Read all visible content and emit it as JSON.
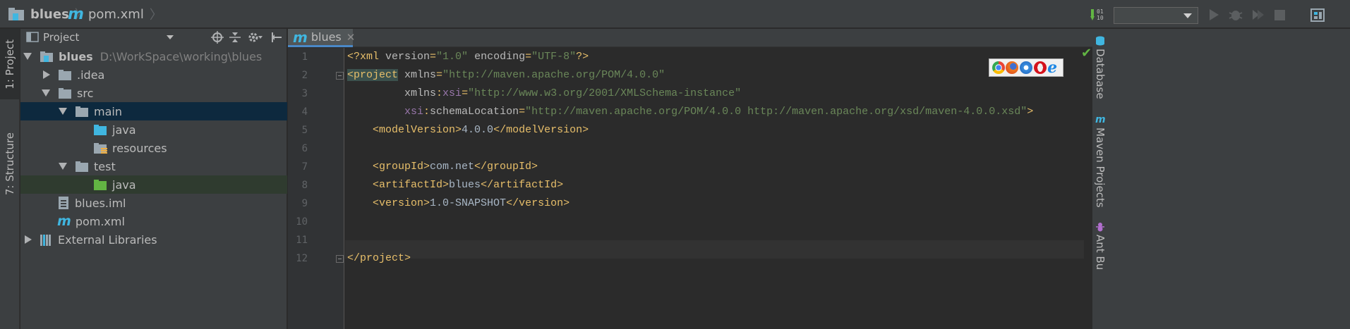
{
  "navbar": {
    "breadcrumbs": [
      "blues",
      "pom.xml"
    ],
    "run_config_value": ""
  },
  "left_strip": {
    "tabs": [
      "1: Project",
      "7: Structure"
    ]
  },
  "project_panel": {
    "title": "Project",
    "tree": [
      {
        "label": "blues",
        "detail": "D:\\WorkSpace\\working\\blues",
        "level": 0,
        "state": "expanded",
        "icon": "module-folder-icon"
      },
      {
        "label": ".idea",
        "level": 1,
        "state": "collapsed",
        "icon": "folder-icon"
      },
      {
        "label": "src",
        "level": 1,
        "state": "expanded",
        "icon": "folder-icon"
      },
      {
        "label": "main",
        "level": 2,
        "state": "expanded",
        "icon": "folder-icon"
      },
      {
        "label": "java",
        "level": 3,
        "state": "leaf",
        "icon": "source-folder-icon"
      },
      {
        "label": "resources",
        "level": 3,
        "state": "leaf",
        "icon": "resources-folder-icon"
      },
      {
        "label": "test",
        "level": 2,
        "state": "expanded",
        "icon": "folder-icon"
      },
      {
        "label": "java",
        "level": 3,
        "state": "leaf",
        "icon": "test-folder-icon"
      },
      {
        "label": "blues.iml",
        "level": 2,
        "state": "leaf",
        "icon": "iml-file-icon"
      },
      {
        "label": "pom.xml",
        "level": 2,
        "state": "leaf",
        "icon": "maven-file-icon"
      },
      {
        "label": "External Libraries",
        "level": 0,
        "state": "collapsed",
        "icon": "libraries-icon"
      }
    ]
  },
  "editor": {
    "tab_label": "blues",
    "line_numbers": [
      "1",
      "2",
      "3",
      "4",
      "5",
      "6",
      "7",
      "8",
      "9",
      "10",
      "11",
      "12"
    ],
    "lines": [
      [
        [
          "tag",
          "<?xml "
        ],
        [
          "attr",
          "version"
        ],
        [
          "tag",
          "="
        ],
        [
          "val",
          "\"1.0\""
        ],
        [
          "tag",
          " "
        ],
        [
          "attr",
          "encoding"
        ],
        [
          "tag",
          "="
        ],
        [
          "val",
          "\"UTF-8\""
        ],
        [
          "tag",
          "?>"
        ]
      ],
      [
        [
          "taghl",
          "<project"
        ],
        [
          "tag",
          " "
        ],
        [
          "attr",
          "xmlns"
        ],
        [
          "tag",
          "="
        ],
        [
          "val",
          "\"http://maven.apache.org/POM/4.0.0\""
        ]
      ],
      [
        [
          "txt",
          "         "
        ],
        [
          "attr",
          "xmlns"
        ],
        [
          "tag",
          ":"
        ],
        [
          "ns",
          "xsi"
        ],
        [
          "tag",
          "="
        ],
        [
          "val",
          "\"http://www.w3.org/2001/XMLSchema-instance\""
        ]
      ],
      [
        [
          "txt",
          "         "
        ],
        [
          "ns",
          "xsi"
        ],
        [
          "tag",
          ":"
        ],
        [
          "attr",
          "schemaLocation"
        ],
        [
          "tag",
          "="
        ],
        [
          "val",
          "\"http://maven.apache.org/POM/4.0.0 http://maven.apache.org/xsd/maven-4.0.0.xsd\""
        ],
        [
          "tag",
          ">"
        ]
      ],
      [
        [
          "txt",
          "    "
        ],
        [
          "tag",
          "<modelVersion>"
        ],
        [
          "txt",
          "4.0.0"
        ],
        [
          "tag",
          "</modelVersion>"
        ]
      ],
      [],
      [
        [
          "txt",
          "    "
        ],
        [
          "tag",
          "<groupId>"
        ],
        [
          "txt",
          "com.net"
        ],
        [
          "tag",
          "</groupId>"
        ]
      ],
      [
        [
          "txt",
          "    "
        ],
        [
          "tag",
          "<artifactId>"
        ],
        [
          "txt",
          "blues"
        ],
        [
          "tag",
          "</artifactId>"
        ]
      ],
      [
        [
          "txt",
          "    "
        ],
        [
          "tag",
          "<version>"
        ],
        [
          "txt",
          "1.0-SNAPSHOT"
        ],
        [
          "tag",
          "</version>"
        ]
      ],
      [],
      [],
      [
        [
          "tag",
          "</project>"
        ]
      ]
    ]
  },
  "right_strip": {
    "tabs": [
      "Database",
      "Maven Projects",
      "Ant Bu"
    ]
  },
  "colors": {
    "accent": "#4a88c7",
    "selection": "#0d293e",
    "tag": "#e8bf6a",
    "string": "#6a8759",
    "ok": "#62b543"
  }
}
